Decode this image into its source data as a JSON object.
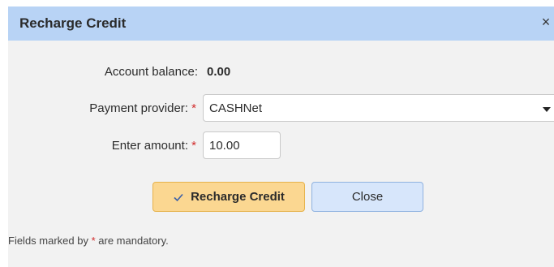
{
  "dialog": {
    "title": "Recharge Credit",
    "close_glyph": "×"
  },
  "form": {
    "balance_label": "Account balance:",
    "balance_value": "0.00",
    "provider_label": "Payment provider:",
    "provider_value": "CASHNet",
    "amount_label": "Enter amount:",
    "amount_value": "10.00",
    "required_marker": "*"
  },
  "buttons": {
    "recharge_label": "Recharge Credit",
    "close_label": "Close"
  },
  "footer": {
    "note_prefix": "Fields marked by ",
    "note_marker": "*",
    "note_suffix": " are mandatory."
  },
  "colors": {
    "titlebar": "#b8d3f5",
    "primary_button": "#fbd791",
    "secondary_button": "#d7e6fb",
    "required": "#d12c2c"
  },
  "icons": {
    "close": "close-icon",
    "check": "check-icon",
    "caret": "chevron-down-icon"
  }
}
